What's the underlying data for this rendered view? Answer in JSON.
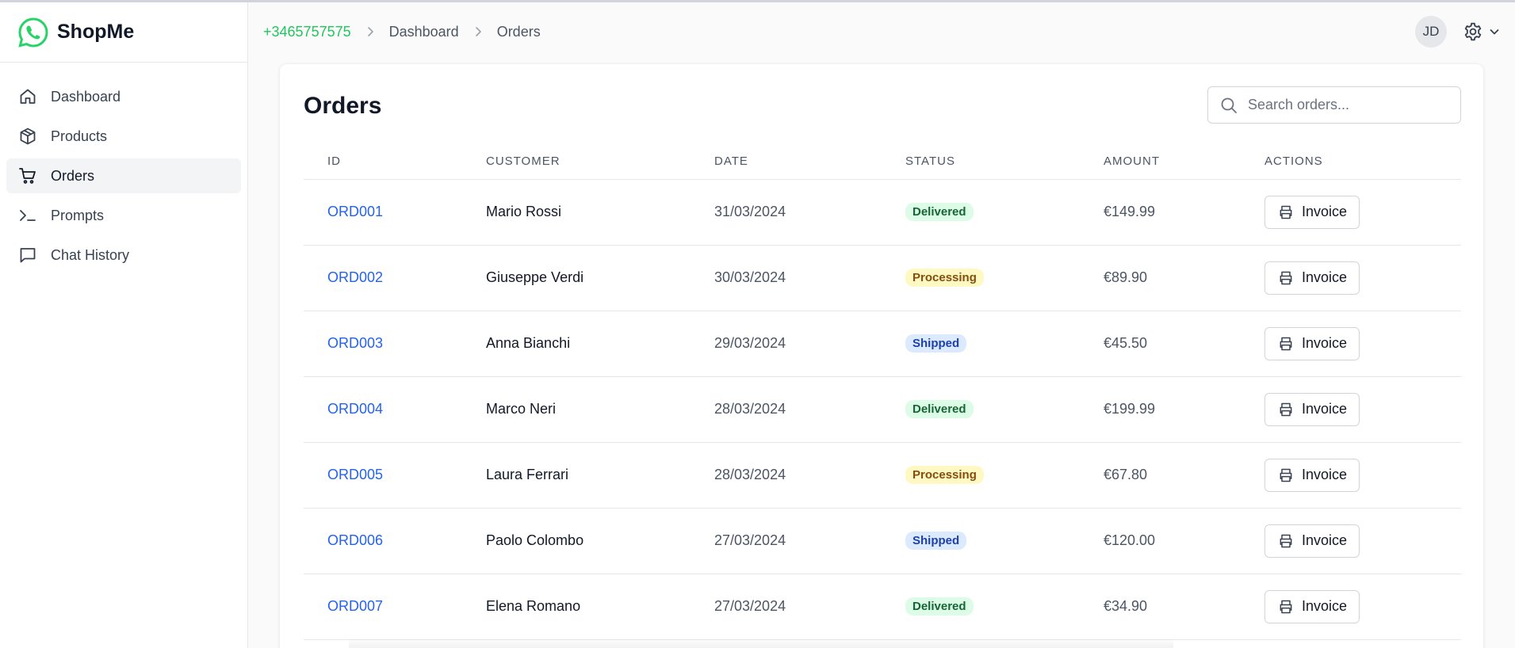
{
  "brand": {
    "name": "ShopMe",
    "accent": "#25D366"
  },
  "sidebar": {
    "items": [
      {
        "label": "Dashboard",
        "icon": "home-icon",
        "active": false
      },
      {
        "label": "Products",
        "icon": "box-icon",
        "active": false
      },
      {
        "label": "Orders",
        "icon": "cart-icon",
        "active": true
      },
      {
        "label": "Prompts",
        "icon": "terminal-icon",
        "active": false
      },
      {
        "label": "Chat History",
        "icon": "chat-icon",
        "active": false
      }
    ]
  },
  "header": {
    "breadcrumb": {
      "phone": "+3465757575",
      "items": [
        "Dashboard",
        "Orders"
      ]
    },
    "avatar_initials": "JD",
    "settings_icon": "gear-icon"
  },
  "main": {
    "title": "Orders",
    "search": {
      "placeholder": "Search orders...",
      "value": ""
    },
    "columns": [
      "ID",
      "CUSTOMER",
      "DATE",
      "STATUS",
      "AMOUNT",
      "ACTIONS"
    ],
    "status_colors": {
      "Delivered": {
        "bg": "#dcfce7",
        "fg": "#166534"
      },
      "Processing": {
        "bg": "#fef9c3",
        "fg": "#854d0e"
      },
      "Shipped": {
        "bg": "#dbeafe",
        "fg": "#1e40af"
      }
    },
    "rows": [
      {
        "id": "ORD001",
        "customer": "Mario Rossi",
        "date": "31/03/2024",
        "status": "Delivered",
        "amount": "€149.99",
        "action": "Invoice"
      },
      {
        "id": "ORD002",
        "customer": "Giuseppe Verdi",
        "date": "30/03/2024",
        "status": "Processing",
        "amount": "€89.90",
        "action": "Invoice"
      },
      {
        "id": "ORD003",
        "customer": "Anna Bianchi",
        "date": "29/03/2024",
        "status": "Shipped",
        "amount": "€45.50",
        "action": "Invoice"
      },
      {
        "id": "ORD004",
        "customer": "Marco Neri",
        "date": "28/03/2024",
        "status": "Delivered",
        "amount": "€199.99",
        "action": "Invoice"
      },
      {
        "id": "ORD005",
        "customer": "Laura Ferrari",
        "date": "28/03/2024",
        "status": "Processing",
        "amount": "€67.80",
        "action": "Invoice"
      },
      {
        "id": "ORD006",
        "customer": "Paolo Colombo",
        "date": "27/03/2024",
        "status": "Shipped",
        "amount": "€120.00",
        "action": "Invoice"
      },
      {
        "id": "ORD007",
        "customer": "Elena Romano",
        "date": "27/03/2024",
        "status": "Delivered",
        "amount": "€34.90",
        "action": "Invoice"
      }
    ]
  }
}
